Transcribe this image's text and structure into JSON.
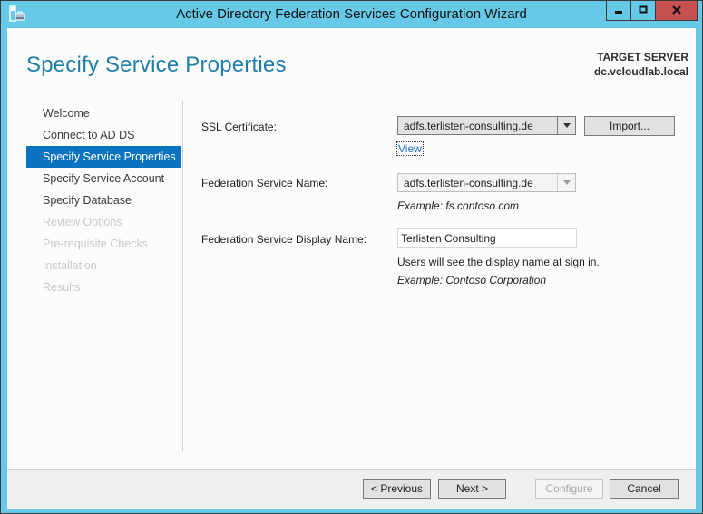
{
  "window": {
    "title": "Active Directory Federation Services Configuration Wizard",
    "controls": {
      "minimize": "minimize",
      "maximize": "maximize",
      "close": "close"
    },
    "accent_color": "#66c9e8",
    "close_color": "#c75050"
  },
  "header": {
    "page_title": "Specify Service Properties",
    "target_label": "TARGET SERVER",
    "target_value": "dc.vcloudlab.local"
  },
  "nav": {
    "items": [
      {
        "label": "Welcome",
        "state": "done"
      },
      {
        "label": "Connect to AD DS",
        "state": "done"
      },
      {
        "label": "Specify Service Properties",
        "state": "active"
      },
      {
        "label": "Specify Service Account",
        "state": "enabled"
      },
      {
        "label": "Specify Database",
        "state": "enabled"
      },
      {
        "label": "Review Options",
        "state": "disabled"
      },
      {
        "label": "Pre-requisite Checks",
        "state": "disabled"
      },
      {
        "label": "Installation",
        "state": "disabled"
      },
      {
        "label": "Results",
        "state": "disabled"
      }
    ],
    "active_color": "#0a73c0"
  },
  "form": {
    "ssl": {
      "label": "SSL Certificate:",
      "value": "adfs.terlisten-consulting.de",
      "import_label": "Import...",
      "view_label": "View"
    },
    "service_name": {
      "label": "Federation Service Name:",
      "value": "adfs.terlisten-consulting.de",
      "example": "Example: fs.contoso.com"
    },
    "display_name": {
      "label": "Federation Service Display Name:",
      "value": "Terlisten Consulting",
      "hint": "Users will see the display name at sign in.",
      "example": "Example: Contoso Corporation"
    }
  },
  "footer": {
    "previous": "< Previous",
    "next": "Next >",
    "configure": "Configure",
    "cancel": "Cancel"
  }
}
